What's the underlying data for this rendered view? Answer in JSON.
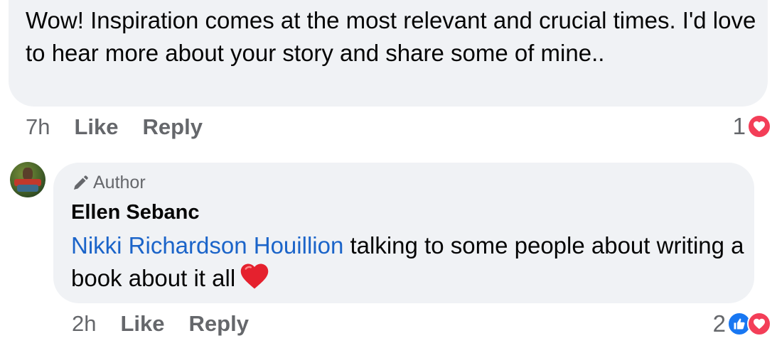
{
  "comment_1": {
    "text": "Wow! Inspiration comes at the most relevant and crucial times. I'd love to hear more about your story and share some of mine..",
    "time": "7h",
    "like_label": "Like",
    "reply_label": "Reply",
    "reaction_count": "1",
    "reactions": [
      "love-icon"
    ]
  },
  "comment_2": {
    "badge": "Author",
    "badge_icon": "pencil-icon",
    "author_name": "Ellen Sebanc",
    "mention": "Nikki Richardson Houillion",
    "text": " talking to some people about writing a book about it all",
    "emoji": "red-heart-emoji",
    "time": "2h",
    "like_label": "Like",
    "reply_label": "Reply",
    "reaction_count": "2",
    "reactions": [
      "like-icon",
      "love-icon"
    ]
  },
  "colors": {
    "bubble": "#f0f2f5",
    "meta_text": "#65676b",
    "mention": "#1b64c9",
    "love": "#f33e58",
    "like": "#1877f2"
  }
}
